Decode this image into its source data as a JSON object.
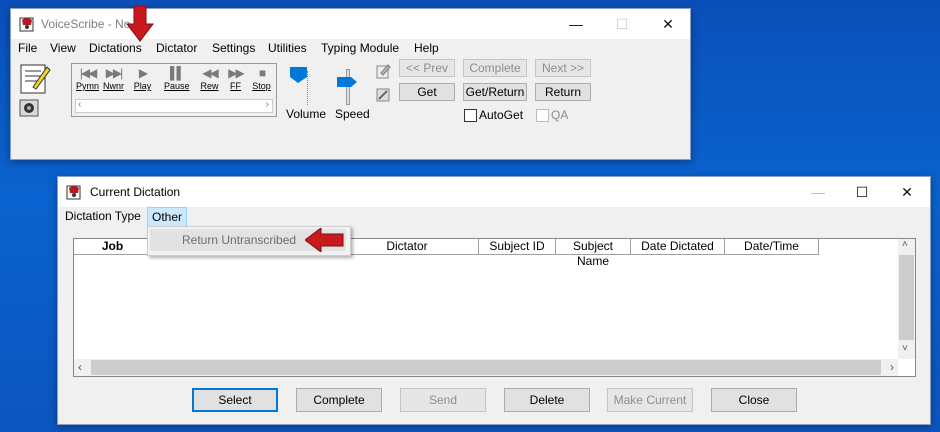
{
  "main_window": {
    "title": "VoiceScribe - No",
    "menu": [
      "File",
      "View",
      "Dictations",
      "Dictator",
      "Settings",
      "Utilities",
      "Typing Module",
      "Help"
    ],
    "transport": [
      {
        "glyph": "|◀◀",
        "label": "Pymn"
      },
      {
        "glyph": "▶▶|",
        "label": "Nwnr"
      },
      {
        "glyph": "▶",
        "label": "Play"
      },
      {
        "glyph": "▌▌",
        "label": "Pause"
      },
      {
        "glyph": "◀◀",
        "label": "Rew"
      },
      {
        "glyph": "▶▶",
        "label": "FF"
      },
      {
        "glyph": "■",
        "label": "Stop"
      }
    ],
    "volume_label": "Volume",
    "speed_label": "Speed",
    "buttons": {
      "prev": "<< Prev",
      "complete": "Complete",
      "next": "Next >>",
      "get": "Get",
      "get_return": "Get/Return",
      "return": "Return"
    },
    "autoget_label": "AutoGet",
    "qa_label": "QA"
  },
  "dialog": {
    "title": "Current Dictation",
    "menu": [
      "Dictation Type",
      "Other"
    ],
    "dropdown_item": "Return Untranscribed",
    "columns": [
      "Job",
      "",
      "",
      "Dictator",
      "Subject ID",
      "Subject Name",
      "Date Dictated",
      "Date/Time"
    ],
    "buttons": {
      "select": "Select",
      "complete": "Complete",
      "send": "Send",
      "delete": "Delete",
      "make_current": "Make Current",
      "close": "Close"
    }
  },
  "colors": {
    "desktop": "#0a5cc8",
    "accent": "#0078d7",
    "arrow": "#c8191c",
    "slider": "#0078d7"
  }
}
